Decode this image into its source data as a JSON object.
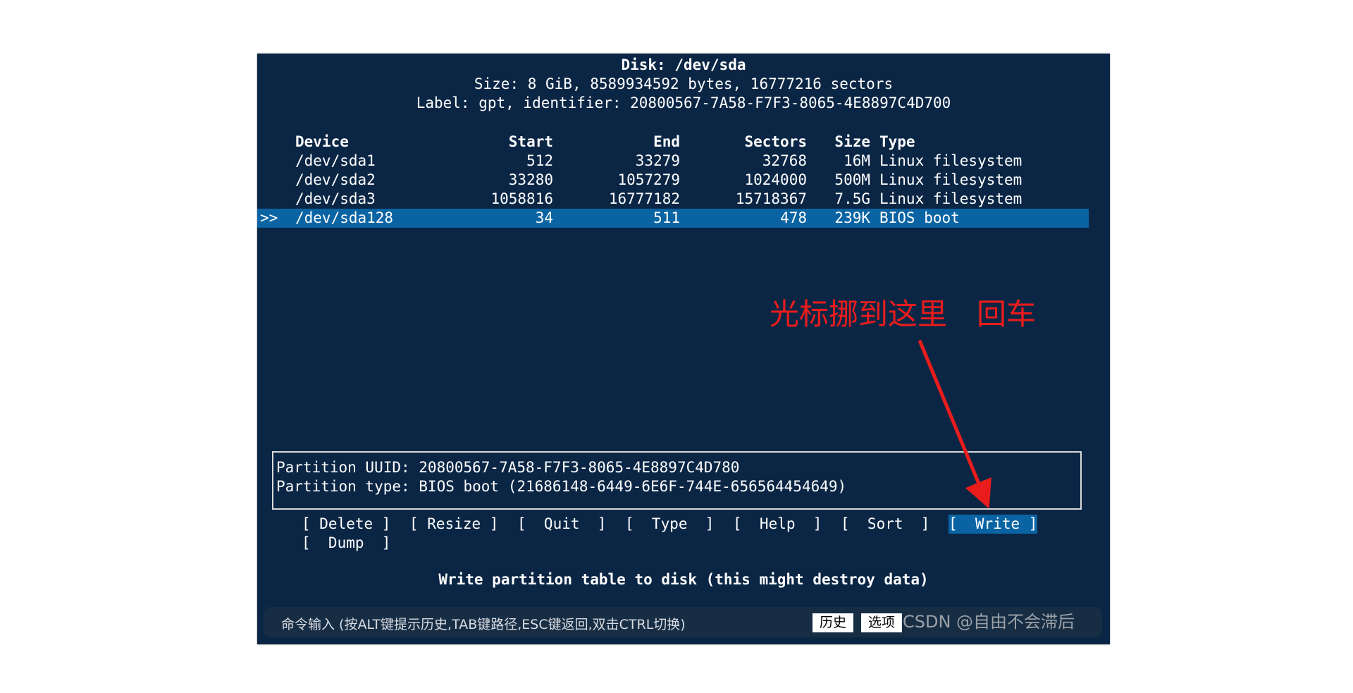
{
  "disk": {
    "title": "Disk: /dev/sda",
    "size_line": "Size: 8 GiB, 8589934592 bytes, 16777216 sectors",
    "label_line": "Label: gpt, identifier: 20800567-7A58-F7F3-8065-4E8897C4D700"
  },
  "table": {
    "headers": {
      "device": "Device",
      "start": "Start",
      "end": "End",
      "sectors": "Sectors",
      "size": "Size",
      "type": "Type"
    },
    "rows": [
      {
        "marker": "",
        "device": "/dev/sda1",
        "start": "512",
        "end": "33279",
        "sectors": "32768",
        "size": "16M",
        "type": "Linux filesystem"
      },
      {
        "marker": "",
        "device": "/dev/sda2",
        "start": "33280",
        "end": "1057279",
        "sectors": "1024000",
        "size": "500M",
        "type": "Linux filesystem"
      },
      {
        "marker": "",
        "device": "/dev/sda3",
        "start": "1058816",
        "end": "16777182",
        "sectors": "15718367",
        "size": "7.5G",
        "type": "Linux filesystem"
      },
      {
        "marker": ">>",
        "device": "/dev/sda128",
        "start": "34",
        "end": "511",
        "sectors": "478",
        "size": "239K",
        "type": "BIOS boot"
      }
    ]
  },
  "info": {
    "uuid_line": "Partition UUID: 20800567-7A58-F7F3-8065-4E8897C4D780",
    "type_line": "Partition type: BIOS boot (21686148-6449-6E6F-744E-656564454649)"
  },
  "menu": {
    "delete": "[ Delete ]",
    "resize": "[ Resize ]",
    "quit": "[  Quit  ]",
    "type": "[  Type  ]",
    "help": "[  Help  ]",
    "sort": "[  Sort  ]",
    "write": "[  Write ]",
    "dump": "[  Dump  ]"
  },
  "status": "Write partition table to disk (this might destroy data)",
  "cmdbar": {
    "hint": "命令输入 (按ALT键提示历史,TAB键路径,ESC键返回,双击CTRL切换)",
    "history_label": "历史",
    "options_label": "选项"
  },
  "watermark": "CSDN @自由不会滞后",
  "annotation": "光标挪到这里　回车",
  "colors": {
    "terminal_bg": "#0b2645",
    "selection": "#0a64a4",
    "annotation": "#ea1c1c"
  }
}
